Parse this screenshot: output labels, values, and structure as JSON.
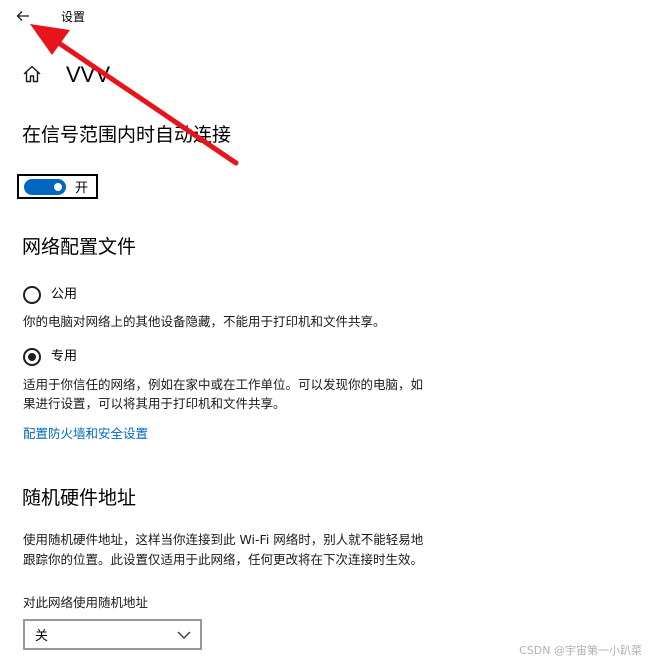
{
  "window": {
    "title": "设置"
  },
  "header": {
    "title": "VVV"
  },
  "auto_connect": {
    "heading": "在信号范围内时自动连接",
    "toggle_state": "开",
    "toggle_on": true
  },
  "network_profile": {
    "heading": "网络配置文件",
    "options": [
      {
        "label": "公用",
        "selected": false,
        "description": "你的电脑对网络上的其他设备隐藏，不能用于打印机和文件共享。"
      },
      {
        "label": "专用",
        "selected": true,
        "description_lines": [
          "适用于你信任的网络，例如在家中或在工作单位。可以发现你的电脑，如",
          "果进行设置，可以将其用于打印机和文件共享。"
        ]
      }
    ],
    "firewall_link": "配置防火墙和安全设置"
  },
  "random_mac": {
    "heading": "随机硬件地址",
    "description_lines": [
      "使用随机硬件地址，这样当你连接到此 Wi-Fi 网络时，别人就不能轻易地",
      "跟踪你的位置。此设置仅适用于此网络，任何更改将在下次连接时生效。"
    ],
    "select_label": "对此网络使用随机地址",
    "select_value": "关"
  },
  "watermark": "CSDN @宇宙第一小趴菜",
  "icons": {
    "back": "back-arrow-icon",
    "home": "home-icon",
    "dropdown": "chevron-down-icon"
  },
  "colors": {
    "accent": "#0067c0",
    "annotation": "#e8141b"
  }
}
